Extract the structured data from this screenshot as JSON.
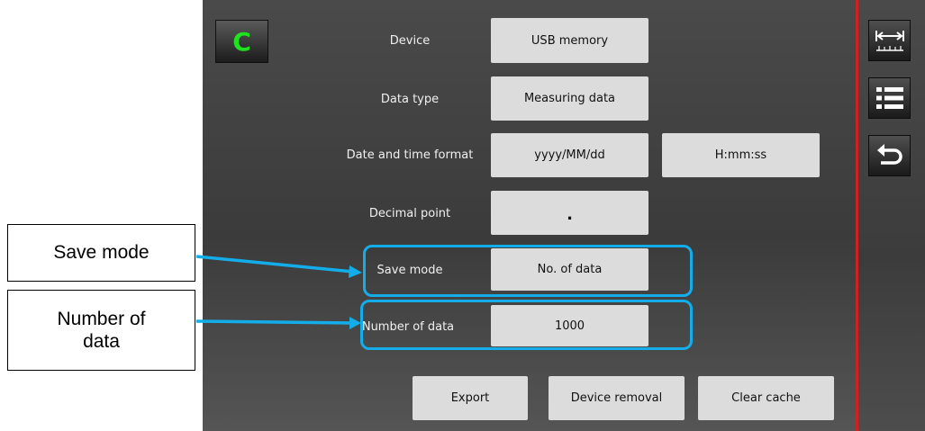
{
  "clear_button": {
    "label": "C",
    "color": "#1de21d"
  },
  "rows": {
    "device": {
      "label": "Device",
      "value": "USB memory"
    },
    "data_type": {
      "label": "Data type",
      "value": "Measuring data"
    },
    "datetime": {
      "label": "Date and time format",
      "date_value": "yyyy/MM/dd",
      "time_value": "H:mm:ss"
    },
    "decimal_point": {
      "label": "Decimal point",
      "value": "."
    },
    "save_mode": {
      "label": "Save mode",
      "value": "No. of data"
    },
    "number_of_data": {
      "label": "Number of data",
      "value": "1000"
    }
  },
  "actions": {
    "export": "Export",
    "device_removal": "Device removal",
    "clear_cache": "Clear cache"
  },
  "sidebar": {
    "icons": [
      "range-icon",
      "list-icon",
      "back-icon"
    ]
  },
  "callouts": {
    "save_mode": "Save mode",
    "number_of_data_line1": "Number of",
    "number_of_data_line2": "data"
  },
  "colors": {
    "highlight": "#13aeea",
    "divider": "#d02020",
    "panel": "#3f3f3f"
  }
}
